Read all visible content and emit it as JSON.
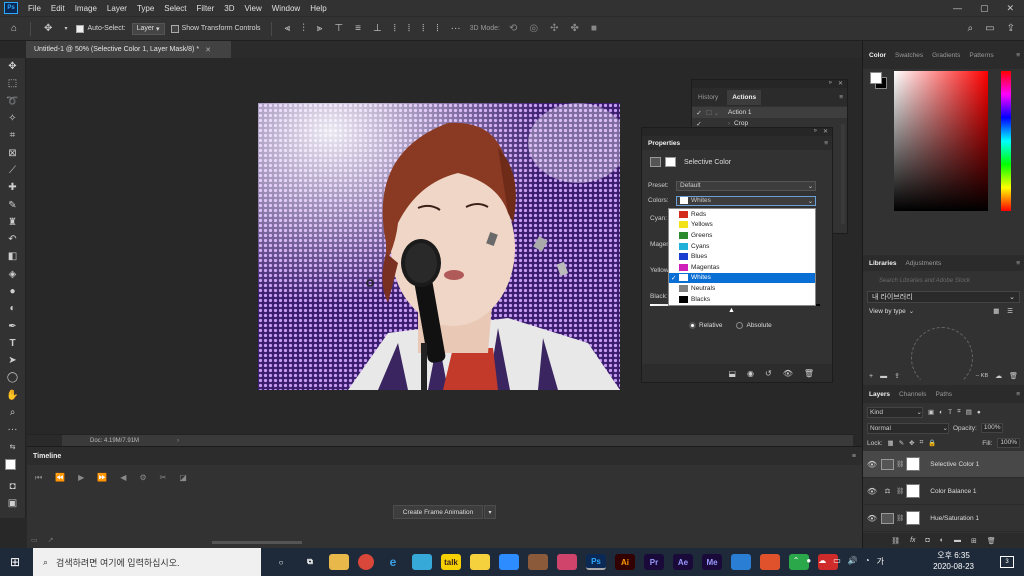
{
  "menubar": {
    "logo": "Ps",
    "items": [
      "File",
      "Edit",
      "Image",
      "Layer",
      "Type",
      "Select",
      "Filter",
      "3D",
      "View",
      "Window",
      "Help"
    ],
    "window_controls": [
      "—",
      "▢",
      "✕"
    ]
  },
  "optbar": {
    "auto_select_label": "Auto-Select:",
    "layer_select": "Layer",
    "show_transform": "Show Transform Controls",
    "mode_3d": "3D Mode:"
  },
  "doc": {
    "tab_title": "Untitled-1 @ 50% (Selective Color 1, Layer Mask/8) *",
    "status": "Doc: 4.19M/7.91M"
  },
  "timeline": {
    "title": "Timeline",
    "create_label": "Create Frame Animation"
  },
  "history_panel": {
    "tabs": [
      "History",
      "Actions"
    ],
    "action_name": "Action 1",
    "sub_item": "Crop"
  },
  "properties": {
    "title": "Properties",
    "adjustment": "Selective Color",
    "preset_label": "Preset:",
    "preset_value": "Default",
    "colors_label": "Colors:",
    "colors_value": "Whites",
    "slider_labels": [
      "Cyan:",
      "Magenta:",
      "Yellow:",
      "Black:"
    ],
    "method_relative": "Relative",
    "method_absolute": "Absolute",
    "method_selected": "Relative"
  },
  "color_dropdown": {
    "options": [
      {
        "label": "Reds",
        "color": "#d42b1f"
      },
      {
        "label": "Yellows",
        "color": "#f2e21a"
      },
      {
        "label": "Greens",
        "color": "#2b8a2b"
      },
      {
        "label": "Cyans",
        "color": "#1fb1d8"
      },
      {
        "label": "Blues",
        "color": "#1b3fd0"
      },
      {
        "label": "Magentas",
        "color": "#d01fb8"
      },
      {
        "label": "Whites",
        "color": "#ffffff"
      },
      {
        "label": "Neutrals",
        "color": "#808080"
      },
      {
        "label": "Blacks",
        "color": "#000000"
      }
    ],
    "selected": "Whites"
  },
  "color_panel": {
    "tabs": [
      "Color",
      "Swatches",
      "Gradients",
      "Patterns"
    ]
  },
  "libraries_panel": {
    "tabs": [
      "Libraries",
      "Adjustments"
    ],
    "search_placeholder": "Search Libraries and Adobe Stock",
    "library_name": "내 라이브러리",
    "view_by": "View by type",
    "size": "-- KB"
  },
  "layers_panel": {
    "tabs": [
      "Layers",
      "Channels",
      "Paths"
    ],
    "kind": "Kind",
    "blend_mode": "Normal",
    "opacity_label": "Opacity:",
    "opacity_value": "100%",
    "lock_label": "Lock:",
    "fill_label": "Fill:",
    "fill_value": "100%",
    "layers": [
      {
        "name": "Selective Color 1",
        "selected": true
      },
      {
        "name": "Color Balance 1",
        "selected": false
      },
      {
        "name": "Hue/Saturation 1",
        "selected": false
      }
    ]
  },
  "taskbar": {
    "search_placeholder": "검색하려면 여기에 입력하십시오.",
    "time": "오후 6:35",
    "date": "2020-08-23",
    "notifications": "3",
    "ime": "가",
    "apps": [
      "Ps",
      "Ai",
      "Pr",
      "Ae",
      "Me"
    ]
  }
}
